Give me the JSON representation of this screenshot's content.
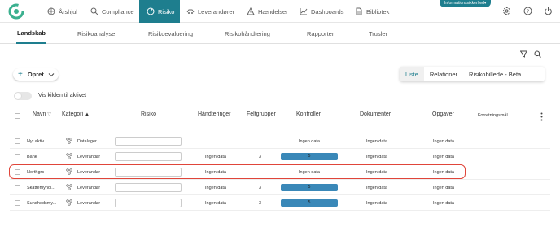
{
  "badge": "Informationssikkerhed",
  "nav": [
    {
      "label": "Årshjul",
      "icon": "wheel-icon"
    },
    {
      "label": "Compliance",
      "icon": "compliance-icon"
    },
    {
      "label": "Risiko",
      "icon": "risk-icon"
    },
    {
      "label": "Leverandører",
      "icon": "supplier-icon"
    },
    {
      "label": "Hændelser",
      "icon": "warning-icon"
    },
    {
      "label": "Dashboards",
      "icon": "chart-icon"
    },
    {
      "label": "Bibliotek",
      "icon": "document-icon"
    }
  ],
  "subtabs": [
    "Landskab",
    "Risikoanalyse",
    "Risikoevaluering",
    "Risikohåndtering",
    "Rapporter",
    "Trusler"
  ],
  "opret_label": "Opret",
  "view_tabs": [
    "Liste",
    "Relationer",
    "Risikobillede - Beta"
  ],
  "toggle_label": "Vis kilden til aktivet",
  "columns": {
    "navn": "Navn",
    "kategori": "Kategori",
    "risiko": "Risiko",
    "handteringer": "Håndteringer",
    "feltgrupper": "Feltgrupper",
    "kontroller": "Kontroller",
    "dokumenter": "Dokumenter",
    "opgaver": "Opgaver",
    "forretningsmal": "Forretningsmål"
  },
  "rows": [
    {
      "navn": "Nyt aktiv",
      "kategori": "Datalager",
      "handteringer": "",
      "feltgrupper": "",
      "kontroller": "Ingen data",
      "dokumenter": "Ingen data",
      "opgaver": "Ingen data"
    },
    {
      "navn": "Bank",
      "kategori": "Leverandør",
      "handteringer": "Ingen data",
      "feltgrupper": "3",
      "kontroller": "5",
      "dokumenter": "Ingen data",
      "opgaver": "Ingen data"
    },
    {
      "navn": "Northgrc",
      "kategori": "Leverandør",
      "handteringer": "Ingen data",
      "feltgrupper": "",
      "kontroller": "Ingen data",
      "dokumenter": "Ingen data",
      "opgaver": "Ingen data"
    },
    {
      "navn": "Skattemyndi...",
      "kategori": "Leverandør",
      "handteringer": "Ingen data",
      "feltgrupper": "3",
      "kontroller": "5",
      "dokumenter": "Ingen data",
      "opgaver": "Ingen data"
    },
    {
      "navn": "Sundhedsmy...",
      "kategori": "Leverandør",
      "handteringer": "Ingen data",
      "feltgrupper": "3",
      "kontroller": "5",
      "dokumenter": "Ingen data",
      "opgaver": "Ingen data"
    }
  ],
  "colors": {
    "accent": "#1e7e8e",
    "bar": "#3a88b8",
    "highlight": "#e0453a"
  }
}
